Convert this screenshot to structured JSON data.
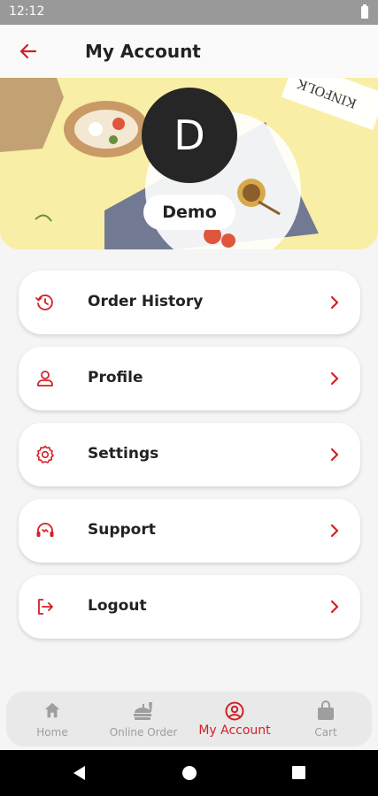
{
  "status_bar": {
    "time": "12:12"
  },
  "app_bar": {
    "title": "My Account"
  },
  "profile": {
    "initial": "D",
    "name": "Demo",
    "banner_text": "KINFOLK"
  },
  "menu": [
    {
      "label": "Order History",
      "icon": "history-icon"
    },
    {
      "label": "Profile",
      "icon": "user-icon"
    },
    {
      "label": "Settings",
      "icon": "gear-icon"
    },
    {
      "label": "Support",
      "icon": "headset-icon"
    },
    {
      "label": "Logout",
      "icon": "logout-icon"
    }
  ],
  "bottom_nav": [
    {
      "label": "Home",
      "icon": "home-icon",
      "active": false
    },
    {
      "label": "Online Order",
      "icon": "food-icon",
      "active": false
    },
    {
      "label": "My Account",
      "icon": "account-icon",
      "active": true
    },
    {
      "label": "Cart",
      "icon": "bag-icon",
      "active": false
    }
  ],
  "colors": {
    "accent": "#d32027",
    "inactive": "#9e9e9e",
    "banner": "#f8eea6"
  }
}
